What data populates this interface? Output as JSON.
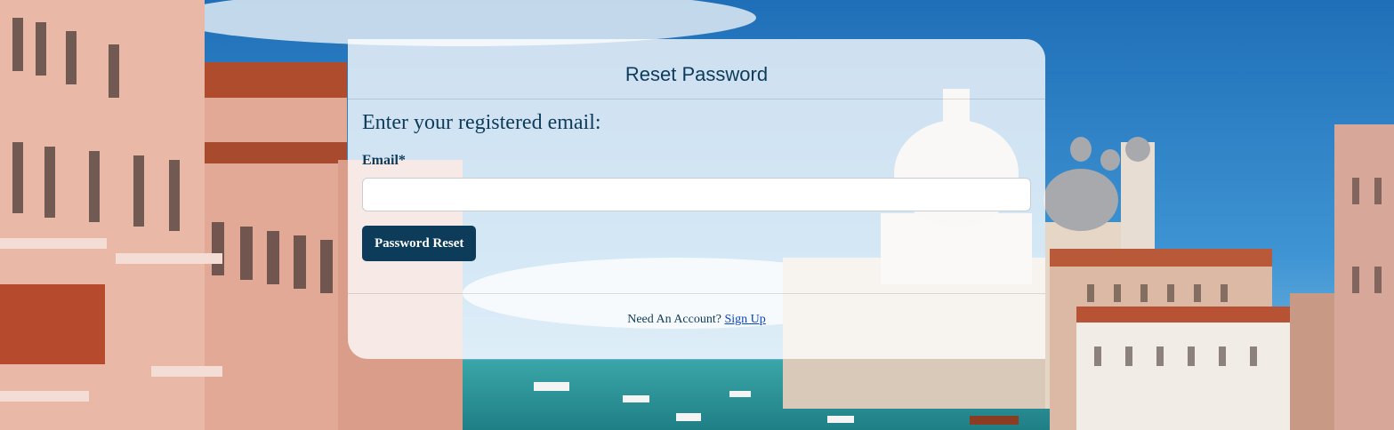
{
  "page": {
    "title": "Reset Password"
  },
  "form": {
    "prompt": "Enter your registered email:",
    "email_label": "Email*",
    "email_value": "",
    "email_placeholder": "",
    "submit_label": "Password Reset"
  },
  "footer": {
    "question": "Need An Account?",
    "signup_link": "Sign Up"
  },
  "colors": {
    "primary": "#0d3b5a",
    "link": "#0645c8",
    "sky": "#2f7fc2",
    "water": "#2a9aa0",
    "building": "#e8b3a3"
  }
}
